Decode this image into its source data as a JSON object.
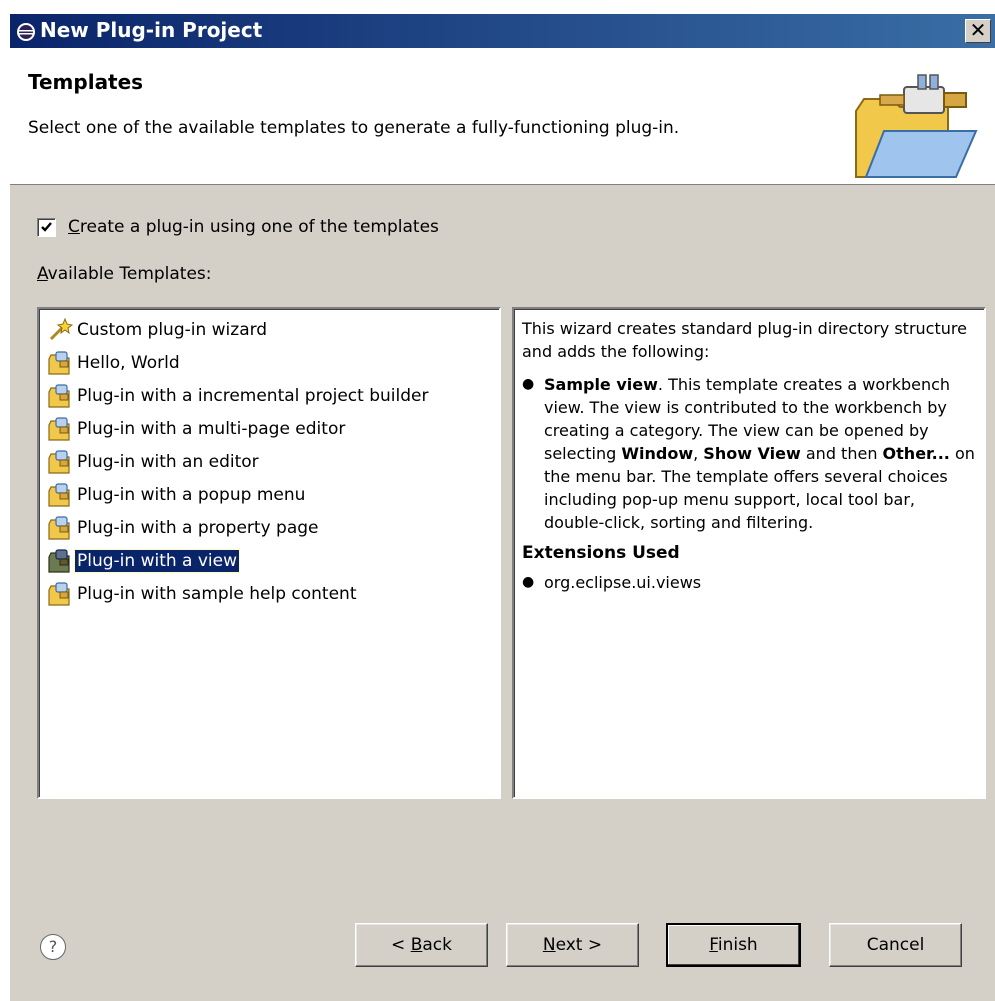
{
  "window": {
    "title": "New Plug-in Project",
    "close_label": "✕"
  },
  "header": {
    "title": "Templates",
    "description": "Select one of the available templates to generate a fully-functioning plug-in."
  },
  "checkbox": {
    "checked": true,
    "mnemonic": "C",
    "label_rest": "reate a plug-in using one of the templates"
  },
  "available": {
    "mnemonic": "A",
    "label_rest": "vailable Templates:"
  },
  "templates": [
    {
      "label": "Custom plug-in wizard",
      "icon": "wizard-icon"
    },
    {
      "label": "Hello, World",
      "icon": "plugin-template-icon"
    },
    {
      "label": "Plug-in with a incremental project builder",
      "icon": "plugin-template-icon"
    },
    {
      "label": "Plug-in with a multi-page editor",
      "icon": "plugin-template-icon"
    },
    {
      "label": "Plug-in with an editor",
      "icon": "plugin-template-icon"
    },
    {
      "label": "Plug-in with a popup menu",
      "icon": "plugin-template-icon"
    },
    {
      "label": "Plug-in with a property page",
      "icon": "plugin-template-icon"
    },
    {
      "label": "Plug-in with a view",
      "icon": "plugin-template-icon",
      "selected": true
    },
    {
      "label": "Plug-in with sample help content",
      "icon": "plugin-template-icon"
    }
  ],
  "description": {
    "intro": "This wizard creates standard plug-in directory structure and adds the following:",
    "bullet_bold": "Sample view",
    "bullet_text_1": ". This template creates a workbench view. The view is contributed to the workbench by creating a category. The view can be opened by selecting ",
    "bold_window": "Window",
    "comma": ", ",
    "bold_show_view": "Show View",
    "and_then": " and then ",
    "bold_other": "Other...",
    "bullet_text_2": " on the menu bar. The template offers several choices including pop-up menu support, local tool bar, double-click, sorting and filtering.",
    "extensions_heading": "Extensions Used",
    "extension": "org.eclipse.ui.views"
  },
  "buttons": {
    "help_icon": "?",
    "back_prefix": "< ",
    "back_mnemonic": "B",
    "back_rest": "ack",
    "next_mnemonic": "N",
    "next_rest": "ext >",
    "finish_mnemonic": "F",
    "finish_rest": "inish",
    "cancel": "Cancel"
  },
  "colors": {
    "selection": "#0a246a",
    "titlebar_start": "#0a246a",
    "titlebar_end": "#3a6ea5",
    "dialog_bg": "#d4d0c8"
  }
}
